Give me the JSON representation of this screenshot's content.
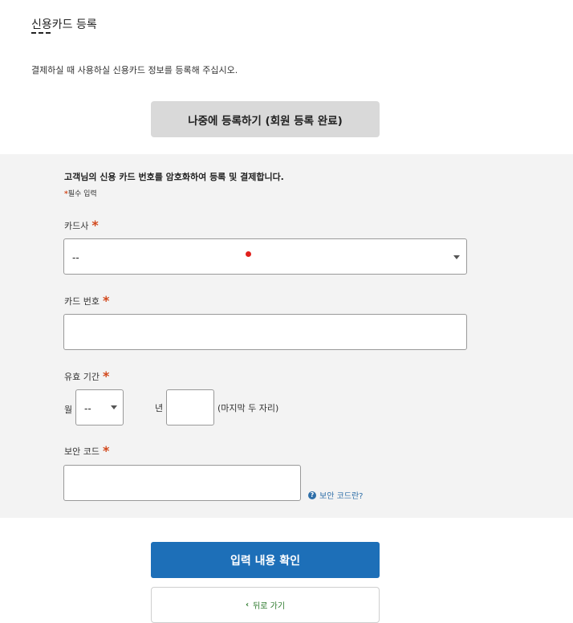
{
  "page": {
    "title": "신용카드 등록",
    "intro": "결제하실 때 사용하실 신용카드 정보를 등록해 주십시오.",
    "register_later_label": "나중에 등록하기 (회원 등록 완료)"
  },
  "form": {
    "notice": "고객님의 신용 카드 번호를 암호화하여 등록 및 결제합니다.",
    "required_star": "*",
    "required_legend": "필수 입력",
    "card_company": {
      "label": "카드사",
      "selected": "--"
    },
    "card_number": {
      "label": "카드 번호",
      "value": ""
    },
    "expiry": {
      "label": "유효 기간",
      "month_label": "월",
      "month_selected": "--",
      "year_label": "년",
      "year_value": "",
      "year_hint": "(마지막 두 자리)"
    },
    "security_code": {
      "label": "보안 코드",
      "value": "",
      "help_icon": "?",
      "help_link": "보안 코드란?"
    }
  },
  "actions": {
    "confirm_label": "입력 내용 확인",
    "back_chevron": "‹",
    "back_label": "뒤로 가기"
  },
  "colors": {
    "required_star": "#d2481c",
    "primary_button": "#1d6fb8",
    "secondary_button": "#d9d9d9",
    "back_link": "#2d7a2d",
    "help_link": "#2f6fa8",
    "panel_background": "#f3f3f3"
  }
}
